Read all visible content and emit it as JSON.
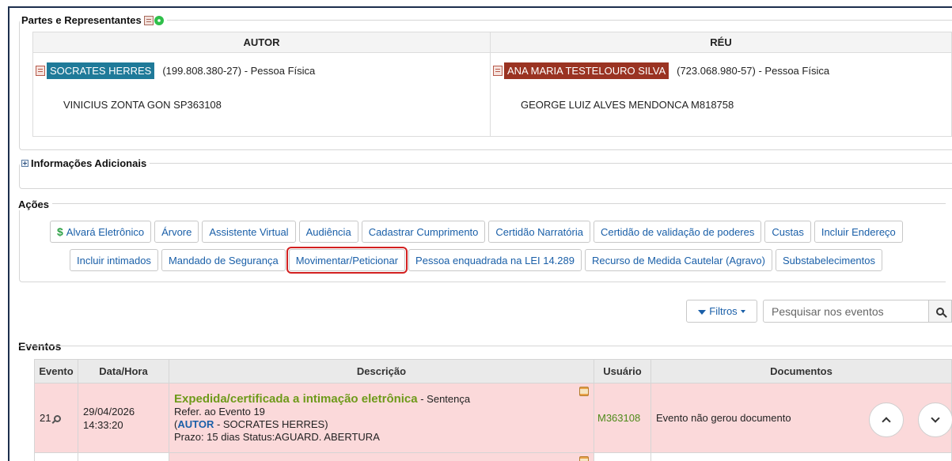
{
  "partes": {
    "title": "Partes e Representantes",
    "autor_header": "AUTOR",
    "reu_header": "RÉU",
    "autor": {
      "name": "SOCRATES HERRES",
      "doc": "(199.808.380-27) - Pessoa Física",
      "rep": "VINICIUS ZONTA GON  SP363108",
      "color": "#1f7a99"
    },
    "reu": {
      "name": "ANA MARIA TESTELOURO SILVA",
      "doc": "(723.068.980-57) - Pessoa Física",
      "rep": "GEORGE LUIZ ALVES MENDONCA  M818758",
      "color": "#9a3322"
    }
  },
  "info": {
    "title": "Informações Adicionais"
  },
  "acoes": {
    "title": "Ações",
    "row1": [
      {
        "label": "Alvará Eletrônico"
      },
      {
        "label": "Árvore"
      },
      {
        "label": "Assistente Virtual"
      },
      {
        "label": "Audiência"
      },
      {
        "label": "Cadastrar Cumprimento"
      },
      {
        "label": "Certidão Narratória"
      },
      {
        "label": "Certidão de validação de poderes"
      },
      {
        "label": "Custas"
      },
      {
        "label": "Incluir Endereço"
      }
    ],
    "row2": [
      {
        "label": "Incluir intimados"
      },
      {
        "label": "Mandado de Segurança"
      },
      {
        "label": "Movimentar/Peticionar"
      },
      {
        "label": "Pessoa enquadrada na LEI 14.289"
      },
      {
        "label": "Recurso de Medida Cautelar (Agravo)"
      },
      {
        "label": "Substabelecimentos"
      }
    ]
  },
  "filtros": {
    "label": "Filtros"
  },
  "search": {
    "placeholder": "Pesquisar nos eventos"
  },
  "eventos": {
    "title": "Eventos",
    "headers": [
      "Evento",
      "Data/Hora",
      "Descrição",
      "Usuário",
      "Documentos"
    ],
    "rows": [
      {
        "evento": "21",
        "data": "29/04/2026",
        "hora": "14:33:20",
        "desc_title": "Expedida/certificada a intimação eletrônica",
        "desc_suffix": " - Sentença",
        "ref": "Refer. ao Evento 19",
        "autor_prefix": "(",
        "autor_label": "AUTOR",
        "autor_suffix": " - SOCRATES HERRES)",
        "prazo": "Prazo: 15 dias Status:AGUARD. ABERTURA",
        "usuario": "M363108",
        "documentos": "Evento não gerou documento"
      }
    ]
  }
}
